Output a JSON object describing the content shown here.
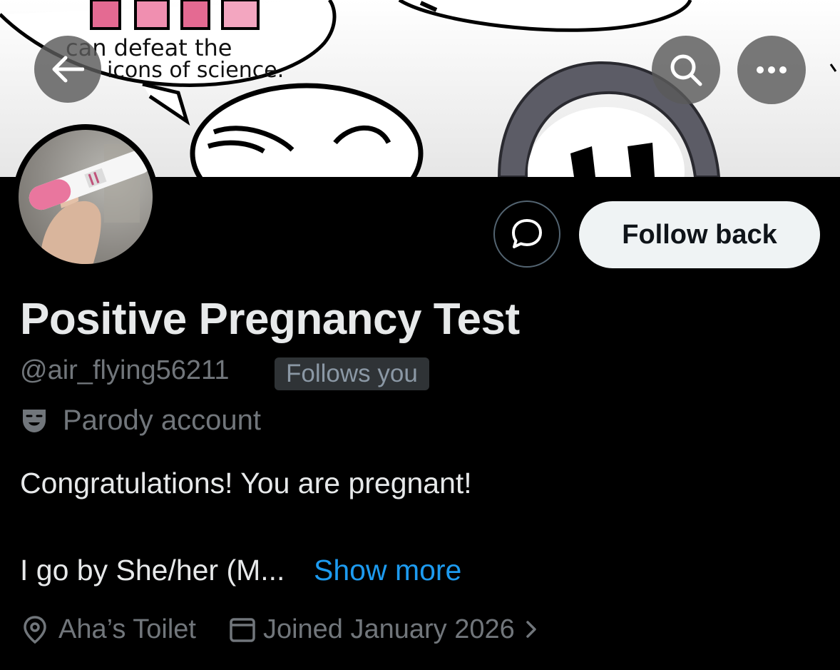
{
  "header": {
    "back_icon": "arrow-left-icon",
    "search_icon": "search-icon",
    "more_icon": "more-horizontal-icon"
  },
  "banner": {
    "text_line_1": "can defeat the",
    "text_line_2": "icons of science."
  },
  "actions": {
    "message_icon": "message-bubble-icon",
    "follow_label": "Follow back"
  },
  "profile": {
    "display_name": "Positive Pregnancy Test",
    "handle": "@air_flying56211",
    "follows_you": "Follows you",
    "parody_label": "Parody account",
    "bio_line_1": "Congratulations! You are pregnant!",
    "bio_line_2": "I go by She/her (M...",
    "show_more": "Show more",
    "location": "Aha’s Toilet",
    "joined": "Joined January 2026"
  },
  "colors": {
    "background": "#000000",
    "text_primary": "#e7e9ea",
    "text_secondary": "#71767b",
    "link": "#1d9bf0",
    "follow_button_bg": "#eff3f4"
  }
}
